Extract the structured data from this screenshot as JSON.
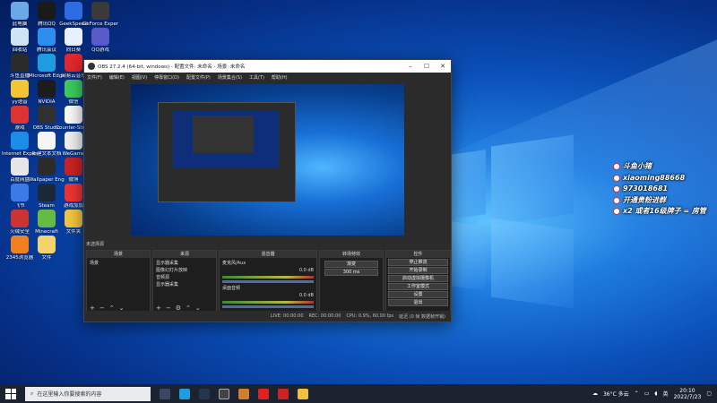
{
  "desktop_icons": [
    {
      "label": "此电脑",
      "color": "#6aa8e8"
    },
    {
      "label": "腾讯QQ",
      "color": "#1a1a1a"
    },
    {
      "label": "GeekSpeed",
      "color": "#2a6de0"
    },
    {
      "label": "GeForce Experience",
      "color": "#3a3a3a"
    },
    {
      "label": "回收站",
      "color": "#cfe4f5"
    },
    {
      "label": "腾讯会议",
      "color": "#2c8ef0"
    },
    {
      "label": "向日葵",
      "color": "#e8efff"
    },
    {
      "label": "QQ游戏",
      "color": "#5a5ac8"
    },
    {
      "label": "斗鱼直播",
      "color": "#2b2b2b"
    },
    {
      "label": "Microsoft Edge",
      "color": "#1f9be0"
    },
    {
      "label": "网易云音乐",
      "color": "#e0282e"
    },
    {
      "label": "yy语音",
      "color": "#f3c433"
    },
    {
      "label": "NVIDIA",
      "color": "#1c1c1c"
    },
    {
      "label": "微信",
      "color": "#3ecb5f"
    },
    {
      "label": "游戏",
      "color": "#d33"
    },
    {
      "label": "OBS Studio",
      "color": "#303030"
    },
    {
      "label": "Counter-Strike",
      "color": "#fafafa"
    },
    {
      "label": "Internet Explorer",
      "color": "#1b8de8"
    },
    {
      "label": "新建文本文档",
      "color": "#f5f5f5"
    },
    {
      "label": "WeGame",
      "color": "#f0f0f0"
    },
    {
      "label": "百度网盘",
      "color": "#e6e6e6"
    },
    {
      "label": "Wallpaper Engine",
      "color": "#2b2b2b"
    },
    {
      "label": "微博",
      "color": "#c22"
    },
    {
      "label": "飞书",
      "color": "#3a7be8"
    },
    {
      "label": "Steam",
      "color": "#1b2838"
    },
    {
      "label": "游戏加加",
      "color": "#e33"
    },
    {
      "label": "火绒安全",
      "color": "#cc3333"
    },
    {
      "label": "Minecraft",
      "color": "#6b4"
    },
    {
      "label": "文件夹",
      "color": "#f4c640"
    },
    {
      "label": "2345浏览器",
      "color": "#f08020"
    },
    {
      "label": "文件",
      "color": "#f3d46a"
    }
  ],
  "obs": {
    "title": "OBS 27.2.4 (64-bit, windows) - 配置文件: 未命名 - 场景: 未命名",
    "menu": [
      "文件(F)",
      "编辑(E)",
      "视图(V)",
      "停靠窗口(D)",
      "配置文件(P)",
      "场景集合(S)",
      "工具(T)",
      "帮助(H)"
    ],
    "scene_label": "未选择源",
    "docks": {
      "scenes": {
        "title": "场景",
        "items": [
          "场景"
        ]
      },
      "sources": {
        "title": "来源",
        "items": [
          "显示器采集",
          "图像幻灯片放映",
          "音频源",
          "显示器采集"
        ]
      },
      "mixer": {
        "title": "混音器",
        "items": [
          "麦克风/Aux",
          "桌面音频"
        ],
        "levels": [
          "0.0 dB",
          "0.0 dB"
        ]
      },
      "transitions": {
        "title": "转场特效",
        "items": [
          "渐变",
          "300 ms"
        ]
      },
      "controls": {
        "title": "控件",
        "buttons": [
          "停止推流",
          "开始录制",
          "启动虚拟摄像机",
          "工作室模式",
          "设置",
          "退出"
        ]
      }
    },
    "status": {
      "live": "LIVE: 00:00:00",
      "rec": "REC: 00:00:00",
      "cpu": "CPU: 0.9%, 60.00 fps",
      "delay": "延迟 (0 帧 数据帧开销)"
    }
  },
  "overlay": {
    "lines": [
      "斗鱼小猪",
      "xiaoming88668",
      "973018681",
      "开通贵粉进群",
      "x2 或者16级牌子 = 房管"
    ]
  },
  "taskbar": {
    "search_placeholder": "在这里输入你要搜索的内容",
    "weather": "36°C 多云",
    "lang": "英",
    "time": "20:10",
    "date": "2022/7/23"
  },
  "colors": {
    "accent": "#0a4fb8",
    "taskbar": "#1b2330",
    "obs_bg": "#2b2b2b"
  }
}
